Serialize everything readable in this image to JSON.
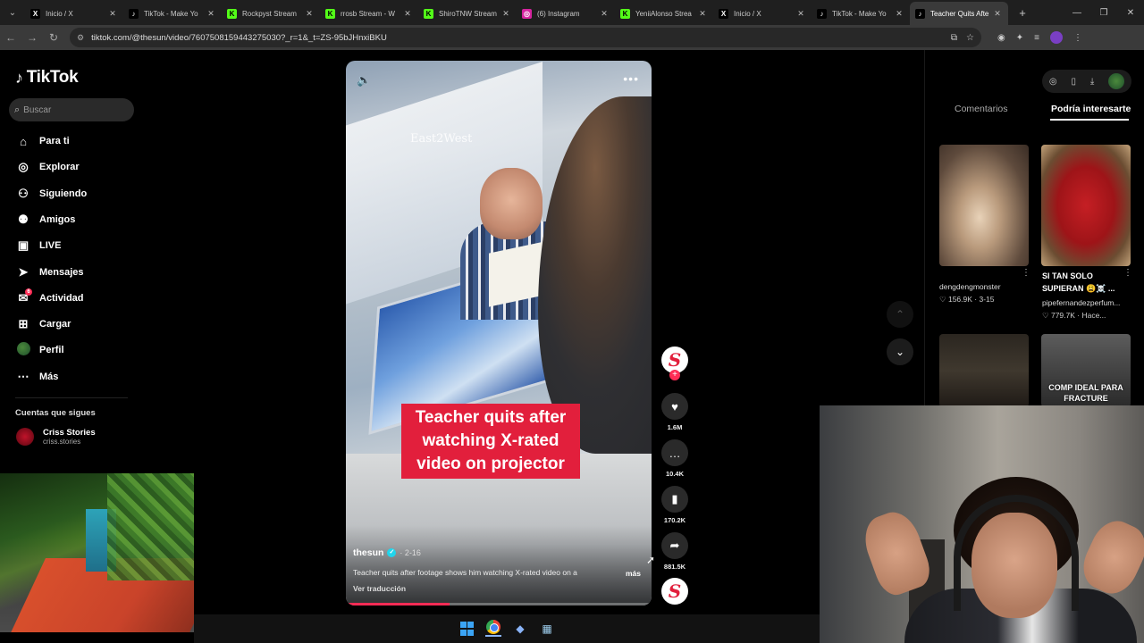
{
  "browser": {
    "tabs": [
      {
        "label": "Inicio / X",
        "favicon": "x-icon",
        "color": "#000000",
        "glyph": "X"
      },
      {
        "label": "TikTok - Make Yo",
        "favicon": "tiktok-icon",
        "color": "#000000",
        "glyph": "♪"
      },
      {
        "label": "Rockpyst Stream",
        "favicon": "kick-icon",
        "color": "#53fc18",
        "glyph": "K"
      },
      {
        "label": "rrosb Stream - W",
        "favicon": "kick-icon",
        "color": "#53fc18",
        "glyph": "K"
      },
      {
        "label": "ShiroTNW Stream",
        "favicon": "kick-icon",
        "color": "#53fc18",
        "glyph": "K"
      },
      {
        "label": "(6) Instagram",
        "favicon": "instagram-icon",
        "color": "#d6249f",
        "glyph": "◎"
      },
      {
        "label": "YeniiAlonso Strea",
        "favicon": "kick-icon",
        "color": "#53fc18",
        "glyph": "K"
      },
      {
        "label": "Inicio / X",
        "favicon": "x-icon",
        "color": "#000000",
        "glyph": "X"
      },
      {
        "label": "TikTok - Make Yo",
        "favicon": "tiktok-icon",
        "color": "#000000",
        "glyph": "♪"
      },
      {
        "label": "Teacher Quits Afte",
        "favicon": "tiktok-icon",
        "color": "#000000",
        "glyph": "♪",
        "active": true
      }
    ],
    "url": "tiktok.com/@thesun/video/7607508159443275030?_r=1&_t=ZS-95bJHnxiBKU"
  },
  "sidebar": {
    "logo": "TikTok",
    "search_placeholder": "Buscar",
    "items": [
      {
        "label": "Para ti",
        "icon": "home-icon"
      },
      {
        "label": "Explorar",
        "icon": "compass-icon"
      },
      {
        "label": "Siguiendo",
        "icon": "following-icon"
      },
      {
        "label": "Amigos",
        "icon": "friends-icon"
      },
      {
        "label": "LIVE",
        "icon": "live-icon"
      },
      {
        "label": "Mensajes",
        "icon": "messages-icon"
      },
      {
        "label": "Actividad",
        "icon": "activity-icon",
        "badge": "6"
      },
      {
        "label": "Cargar",
        "icon": "upload-icon"
      },
      {
        "label": "Perfil",
        "icon": "profile-avatar"
      },
      {
        "label": "Más",
        "icon": "more-icon"
      }
    ],
    "following_title": "Cuentas que sigues",
    "followed": {
      "name": "Criss Stories",
      "handle": "criss.stories"
    }
  },
  "video": {
    "watermark": "East2West",
    "caption": "Teacher quits after watching X-rated video on projector",
    "author": "thesun",
    "date": "· 2-16",
    "description": "Teacher quits after footage shows him watching X-rated video on a",
    "more_label": "más",
    "translate_label": "Ver traducción",
    "progress": 0.34
  },
  "actions": {
    "likes": "1.6M",
    "comments": "10.4K",
    "saves": "170.2K",
    "shares": "881.5K"
  },
  "right_panel": {
    "tabs": {
      "comments": "Comentarios",
      "suggested": "Podría interesarte"
    },
    "cards": [
      {
        "user": "dengdengmonster",
        "meta": "♡ 156.9K · 3-15"
      },
      {
        "title": "SI TAN SOLO SUPIERAN 😩☠️ ...",
        "user": "pipefernandezperfum...",
        "meta": "♡ 779.7K · Hace..."
      }
    ],
    "thumb_text": "COMP IDEAL PARA FRACTURE"
  },
  "colors": {
    "accent": "#fe2c55",
    "caption_bg": "#e21f3c",
    "verified": "#20d5ec"
  }
}
